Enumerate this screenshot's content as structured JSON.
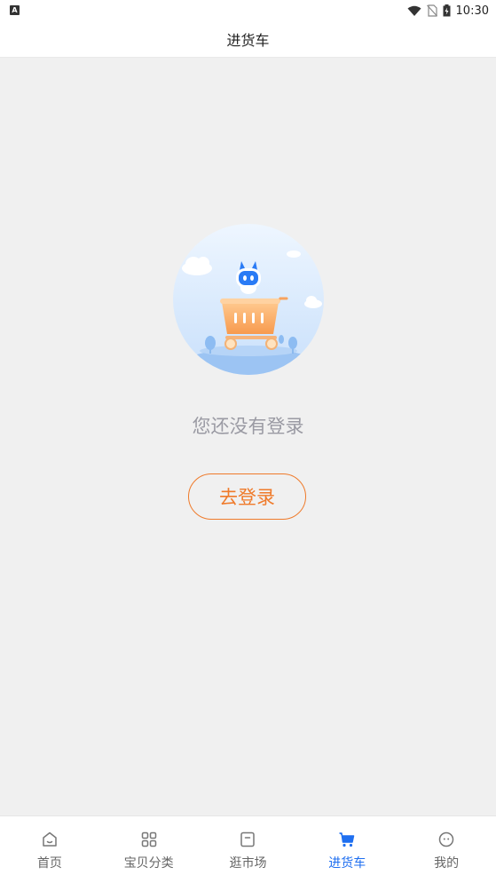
{
  "status_bar": {
    "time": "10:30",
    "left_badge": "A"
  },
  "header": {
    "title": "进货车"
  },
  "empty_state": {
    "message": "您还没有登录",
    "login_button": "去登录"
  },
  "tab_bar": {
    "active_index": 3,
    "items": [
      {
        "label": "首页",
        "icon": "home-icon"
      },
      {
        "label": "宝贝分类",
        "icon": "grid-icon"
      },
      {
        "label": "逛市场",
        "icon": "market-icon"
      },
      {
        "label": "进货车",
        "icon": "cart-icon"
      },
      {
        "label": "我的",
        "icon": "profile-icon"
      }
    ]
  },
  "colors": {
    "accent": "#1f6ff0",
    "login": "#ef7a2a",
    "background": "#f0f0f0"
  }
}
